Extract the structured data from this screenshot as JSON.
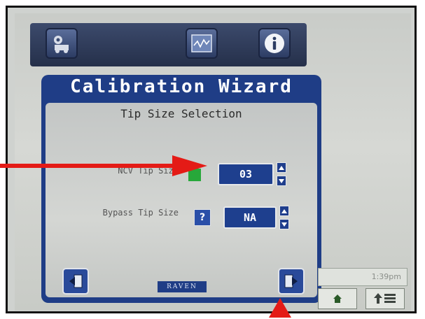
{
  "wizard": {
    "title": "Calibration Wizard",
    "subtitle": "Tip Size Selection",
    "row1": {
      "label": "NCV Tip Size",
      "value": "03"
    },
    "row2": {
      "label": "Bypass Tip Size",
      "help_label": "?",
      "value": "NA"
    },
    "logo": "RAVEN"
  },
  "status": {
    "time": "1:39pm"
  },
  "icons": [
    "machine-settings-icon",
    "performance-graph-icon",
    "info-icon",
    "back-arrow-icon",
    "next-arrow-icon",
    "home-icon",
    "menu-icon"
  ],
  "colors": {
    "wizard_blue": "#1f3d86",
    "annotation_red": "#e41b16",
    "value_green": "#27a83a"
  }
}
